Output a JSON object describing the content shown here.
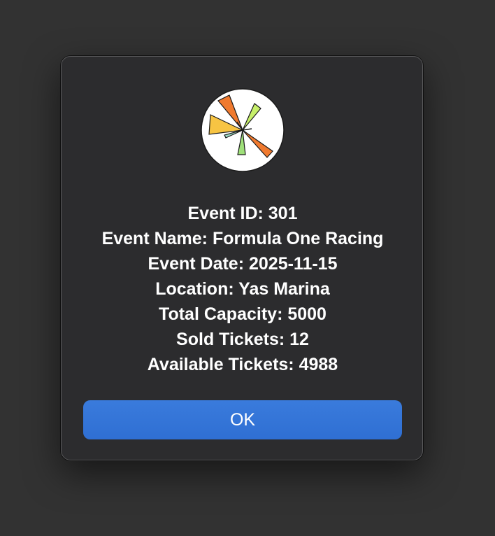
{
  "dialog": {
    "icon": "pinwheel-app-icon",
    "lines": {
      "event_id": "Event ID: 301",
      "event_name": "Event Name: Formula One Racing",
      "event_date": "Event Date: 2025-11-15",
      "location": "Location: Yas Marina",
      "total_capacity": "Total Capacity: 5000",
      "sold_tickets": "Sold Tickets: 12",
      "available_tickets": "Available Tickets: 4988"
    },
    "ok_label": "OK"
  },
  "colors": {
    "background": "#323232",
    "dialog": "#2c2c2e",
    "button": "#3a7bdc",
    "icon_orange": "#f07a2f",
    "icon_yellow": "#f7c443",
    "icon_lime": "#c7f06a",
    "icon_green": "#9fe07a",
    "icon_teal": "#9fdcc4"
  }
}
